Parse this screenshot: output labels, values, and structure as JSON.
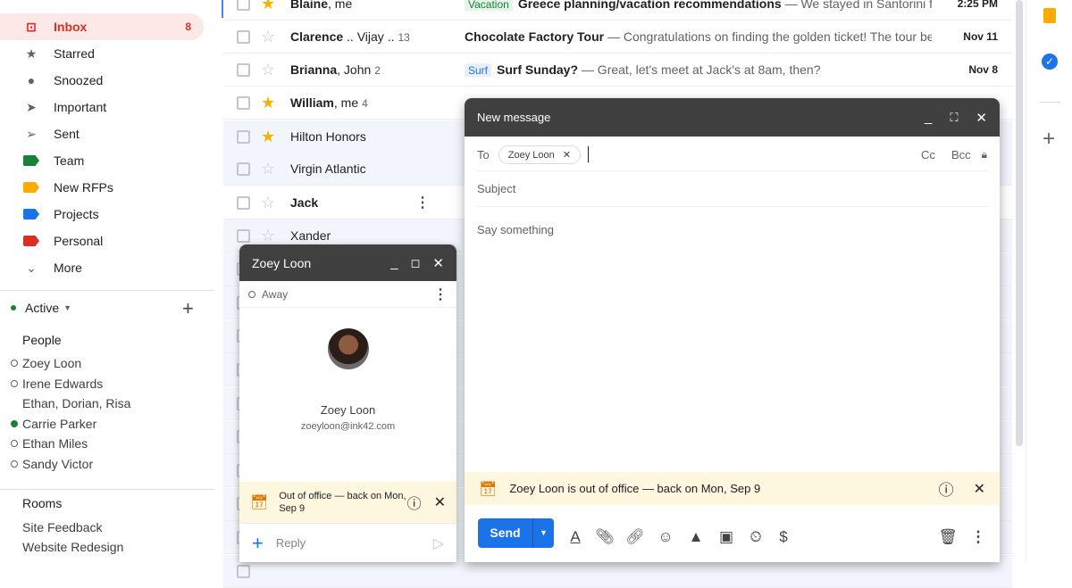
{
  "sidebar": {
    "items": [
      {
        "label": "Inbox",
        "count": "8",
        "icon": "inbox-icon",
        "active": true
      },
      {
        "label": "Starred",
        "icon": "star-icon"
      },
      {
        "label": "Snoozed",
        "icon": "clock-icon"
      },
      {
        "label": "Important",
        "icon": "important-icon"
      },
      {
        "label": "Sent",
        "icon": "send-icon"
      },
      {
        "label": "Team",
        "icon": "label-icon",
        "color": "#188038"
      },
      {
        "label": "New RFPs",
        "icon": "label-icon",
        "color": "#f9ab00"
      },
      {
        "label": "Projects",
        "icon": "label-icon",
        "color": "#1a73e8"
      },
      {
        "label": "Personal",
        "icon": "label-icon",
        "color": "#d93025"
      },
      {
        "label": "More",
        "icon": "chevron-down-icon"
      }
    ],
    "status": "Active",
    "people_heading": "People",
    "people": [
      {
        "name": "Zoey Loon",
        "online": false
      },
      {
        "name": "Irene Edwards",
        "online": false
      },
      {
        "name": "Ethan, Dorian, Risa",
        "group": true
      },
      {
        "name": "Carrie Parker",
        "online": true
      },
      {
        "name": "Ethan Miles",
        "online": false
      },
      {
        "name": "Sandy Victor",
        "online": false
      }
    ],
    "rooms_heading": "Rooms",
    "rooms": [
      "Site Feedback",
      "Website Redesign"
    ]
  },
  "emails": [
    {
      "from": "Blaine",
      "from_rest": ", me",
      "count": "",
      "starred": true,
      "unread": true,
      "tag": "Vacation",
      "tag_color": "#188038",
      "tag_bg": "#e6f4ea",
      "subject": "Greece planning/vacation recommendations",
      "snippet": " — We stayed in Santorini for the...",
      "date": "2:25 PM"
    },
    {
      "from": "Clarence",
      "from_rest": " .. Vijay ..",
      "count": "13",
      "starred": false,
      "unread": true,
      "subject": "Chocolate Factory Tour",
      "snippet": " — Congratulations on finding the golden ticket! The tour begins...",
      "date": "Nov 11"
    },
    {
      "from": "Brianna",
      "from_rest": ", John",
      "count": "2",
      "starred": false,
      "unread": true,
      "tag": "Surf",
      "tag_color": "#1a73e8",
      "tag_bg": "#e8f0fe",
      "subject": "Surf Sunday?",
      "snippet": " — Great, let's meet at Jack's at 8am, then?",
      "date": "Nov 8"
    },
    {
      "from": "William",
      "from_rest": ", me",
      "count": "4",
      "starred": true,
      "unread": true
    },
    {
      "from": "Hilton Honors",
      "starred": true,
      "unread": false
    },
    {
      "from": "Virgin Atlantic",
      "starred": false,
      "unread": false
    },
    {
      "from": "Jack",
      "starred": false,
      "unread": true
    },
    {
      "from": "Xander",
      "starred": false,
      "unread": false
    }
  ],
  "chat": {
    "name": "Zoey Loon",
    "status": "Away",
    "email": "zoeyloon@ink42.com",
    "ooo": "Out of office — back on Mon, Sep 9",
    "reply_placeholder": "Reply"
  },
  "compose": {
    "title": "New message",
    "to_label": "To",
    "recipient": "Zoey Loon",
    "cc": "Cc",
    "bcc": "Bcc",
    "subject_placeholder": "Subject",
    "body_placeholder": "Say something",
    "ooo": "Zoey Loon is out of office — back on Mon, Sep 9",
    "send": "Send"
  },
  "colors": {
    "accent": "#1a73e8",
    "inbox": "#d93025",
    "ooo_bg": "#fef7e0"
  }
}
